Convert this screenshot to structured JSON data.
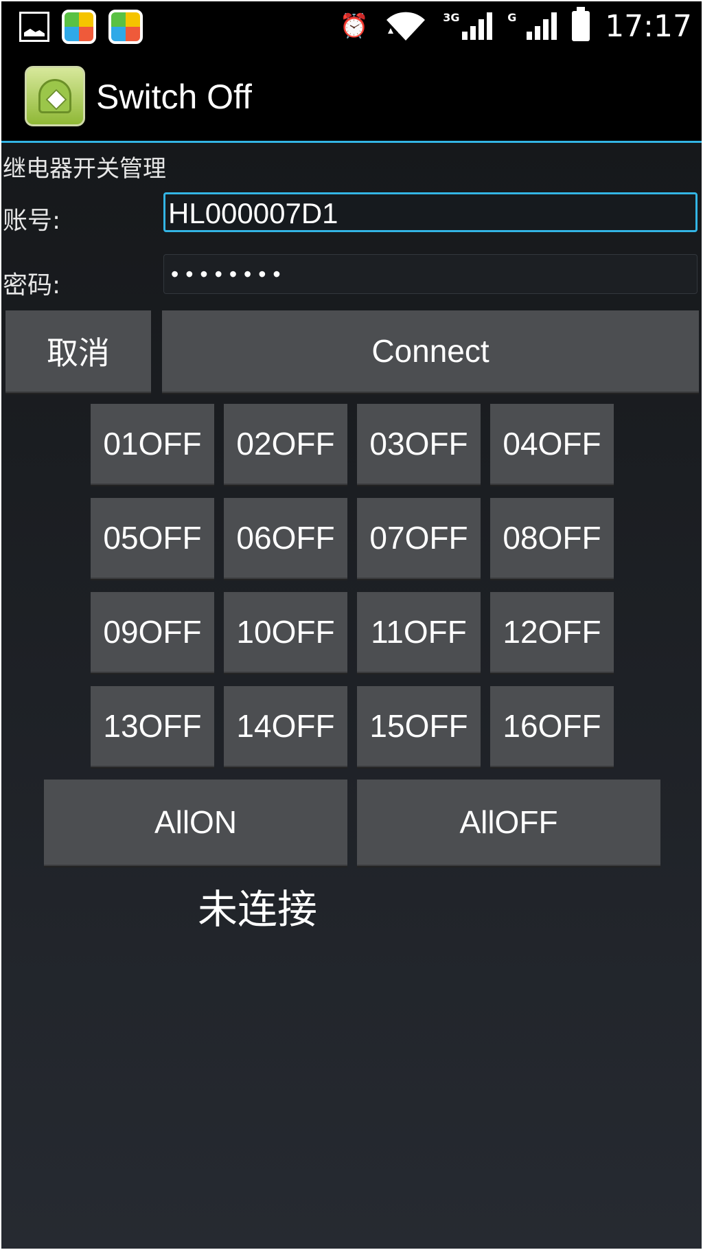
{
  "status_bar": {
    "time": "17:17",
    "network_tags": [
      "3G",
      "G"
    ],
    "icons": [
      "picture-icon",
      "app-market-icon",
      "app-market-icon",
      "alarm-icon",
      "wifi-icon",
      "signal-icon",
      "signal-icon",
      "battery-icon"
    ]
  },
  "action_bar": {
    "title": "Switch Off"
  },
  "form": {
    "section_title": "继电器开关管理",
    "account_label": "账号:",
    "account_value": "HL000007D1",
    "password_label": "密码:",
    "password_value": "••••••••",
    "cancel_label": "取消",
    "connect_label": "Connect"
  },
  "relays": [
    "01OFF",
    "02OFF",
    "03OFF",
    "04OFF",
    "05OFF",
    "06OFF",
    "07OFF",
    "08OFF",
    "09OFF",
    "10OFF",
    "11OFF",
    "12OFF",
    "13OFF",
    "14OFF",
    "15OFF",
    "16OFF"
  ],
  "all_on_label": "AllON",
  "all_off_label": "AllOFF",
  "connection_status": "未连接",
  "colors": {
    "accent": "#33b5e5",
    "button": "#4c4e51"
  }
}
